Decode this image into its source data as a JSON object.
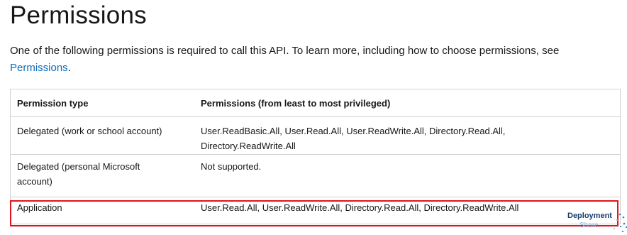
{
  "heading": "Permissions",
  "intro": {
    "text": "One of the following permissions is required to call this API. To learn more, including how to choose permissions, see",
    "link_text": "Permissions",
    "after_link": "."
  },
  "table": {
    "headers": [
      "Permission type",
      "Permissions (from least to most privileged)"
    ],
    "rows": [
      {
        "type": "Delegated (work or school account)",
        "permissions_line1": "User.ReadBasic.All, User.Read.All, User.ReadWrite.All, Directory.Read.All,",
        "permissions_line2": "Directory.ReadWrite.All"
      },
      {
        "type_line1": "Delegated (personal Microsoft",
        "type_line2": "account)",
        "permissions": "Not supported."
      },
      {
        "type": "Application",
        "permissions": "User.Read.All, User.ReadWrite.All, Directory.Read.All, Directory.ReadWrite.All"
      }
    ]
  },
  "highlight": {
    "color": "#e1141c",
    "row": "Application"
  },
  "watermark": {
    "line1": "Deployment",
    "line2": "Share"
  },
  "colors": {
    "link": "#0f6cbd",
    "text": "#171717",
    "border": "#d1d1d1"
  }
}
